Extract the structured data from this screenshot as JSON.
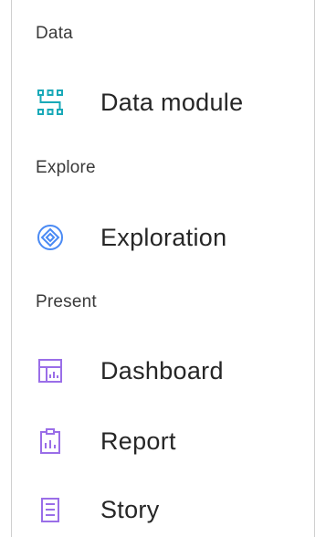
{
  "sections": [
    {
      "label": "Data",
      "items": [
        {
          "label": "Data module",
          "icon": "data-module-icon",
          "color": "#19a9b8"
        }
      ]
    },
    {
      "label": "Explore",
      "items": [
        {
          "label": "Exploration",
          "icon": "exploration-icon",
          "color": "#4a8af4"
        }
      ]
    },
    {
      "label": "Present",
      "items": [
        {
          "label": "Dashboard",
          "icon": "dashboard-icon",
          "color": "#9a6ee8"
        },
        {
          "label": "Report",
          "icon": "report-icon",
          "color": "#9a6ee8"
        },
        {
          "label": "Story",
          "icon": "story-icon",
          "color": "#9a6ee8"
        }
      ]
    }
  ]
}
